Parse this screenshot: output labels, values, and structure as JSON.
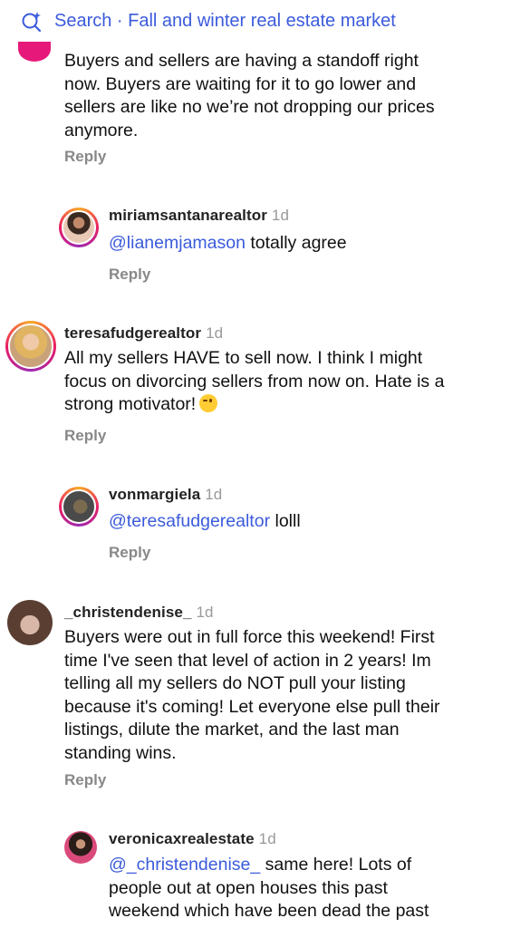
{
  "search": {
    "label": "Search · Fall and winter real estate market"
  },
  "reply_label": "Reply",
  "comments": [
    {
      "username": "",
      "age": "",
      "text_lines": [
        "Buyers and sellers are having a standoff right",
        "now. Buyers are waiting for it to go lower and",
        "sellers are like no we’re not dropping our prices",
        "anymore."
      ]
    },
    {
      "username": "miriamsantanarealtor",
      "age": "1d",
      "mention": "@lianemjamason",
      "text": " totally agree"
    },
    {
      "username": "teresafudgerealtor",
      "age": "1d",
      "text_lines": [
        "All my sellers HAVE to sell now. I think I might",
        "focus on divorcing sellers from now on. Hate is a",
        "strong motivator!"
      ],
      "emoji": "winking-face"
    },
    {
      "username": "vonmargiela",
      "age": "1d",
      "mention": "@teresafudgerealtor",
      "text": " lolll"
    },
    {
      "username": "_christendenise_",
      "age": "1d",
      "text_lines": [
        "Buyers were out in full force this weekend! First",
        "time I've seen that level of action in 2 years! Im",
        "telling all my sellers do NOT pull your listing",
        "because it's coming! Let everyone else pull their",
        "listings, dilute the market, and the last man",
        "standing wins."
      ]
    },
    {
      "username": "veronicaxrealestate",
      "age": "1d",
      "mention": "@_christendenise_",
      "text_lines": [
        " same here! Lots of",
        "people out at open houses this past",
        "weekend which have been dead the past"
      ]
    }
  ],
  "colors": {
    "link": "#3b5bdb",
    "muted": "#888888"
  }
}
